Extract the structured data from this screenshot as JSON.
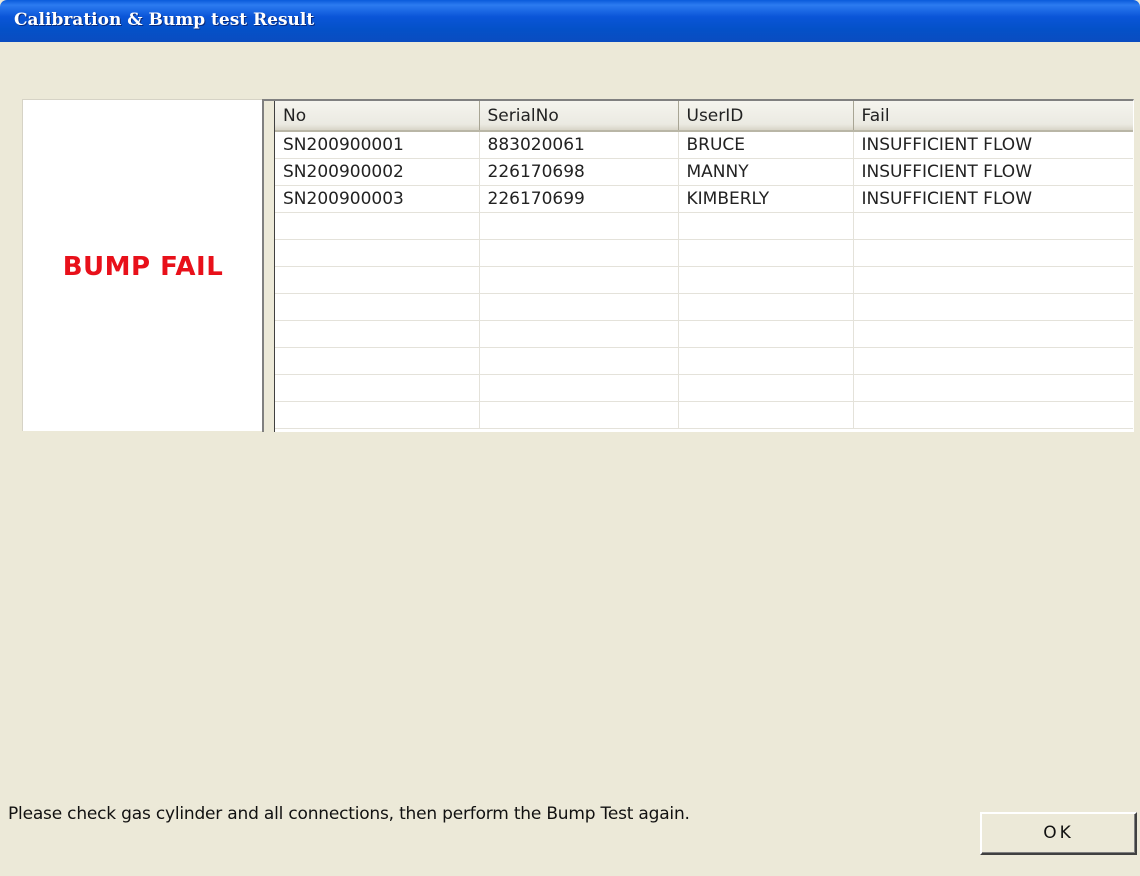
{
  "window": {
    "title": "Calibration & Bump test Result"
  },
  "status": {
    "text": "BUMP FAIL",
    "color": "#E8101A"
  },
  "table": {
    "columns": [
      "No",
      "SerialNo",
      "UserID",
      "Fail"
    ],
    "rows": [
      [
        "SN200900001",
        "883020061",
        "BRUCE",
        "INSUFFICIENT FLOW"
      ],
      [
        "SN200900002",
        "226170698",
        "MANNY",
        "INSUFFICIENT FLOW"
      ],
      [
        "SN200900003",
        "226170699",
        "KIMBERLY",
        "INSUFFICIENT FLOW"
      ]
    ],
    "empty_rows": 8
  },
  "footer": {
    "message": "Please check gas cylinder and all connections, then perform the Bump Test again.",
    "ok_label": "OK"
  },
  "colors": {
    "titlebar": "#0A55D8",
    "dialog_background": "#ECE9D8",
    "fail_text": "#E8101A"
  }
}
